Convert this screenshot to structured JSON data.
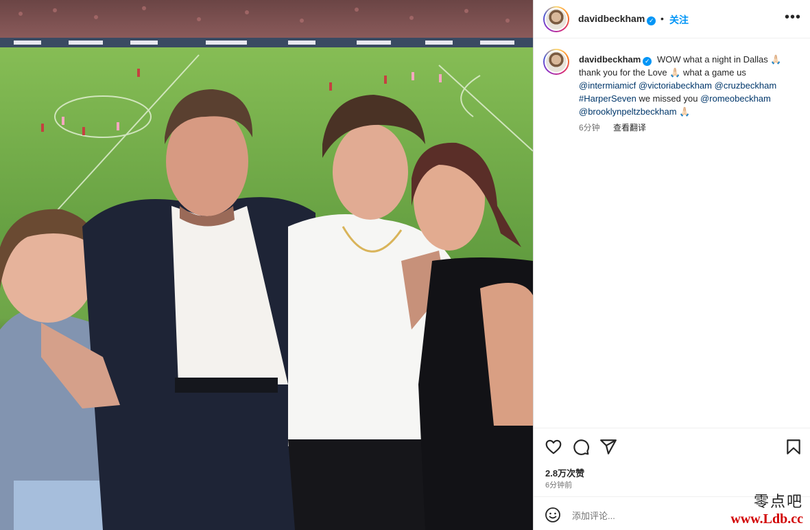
{
  "post": {
    "photo_alt": "",
    "header": {
      "username": "davidbeckham",
      "verified_mark": "✓",
      "separator": "•",
      "follow_label": "关注",
      "more_label": "•••"
    },
    "caption": {
      "username": "davidbeckham",
      "line1": "WOW what a night in Dallas 🙏🏻",
      "line2": "thank you for the Love 🙏🏻 what a game us",
      "mention1": "@intermiamicf",
      "mention2": "@victoriabeckham",
      "mention3": "@cruzbeckham",
      "hashtag": "#HarperSeven",
      "missed": "we missed you",
      "mention4": "@romeobeckham",
      "mention5": "@brooklynpeltzbeckham",
      "emoji_end": "🙏🏻",
      "age": "6分钟",
      "translate_label": "查看翻译"
    },
    "actions": {
      "like_icon": "heart-icon",
      "comment_icon": "comment-icon",
      "share_icon": "share-icon",
      "save_icon": "bookmark-icon"
    },
    "likes_label": "2.8万次赞",
    "time_label": "6分钟前",
    "comment": {
      "emoji_icon": "smiley-icon",
      "placeholder": "添加评论..."
    }
  },
  "watermark": {
    "cn": "零点吧",
    "url": "www.Ldb.cc"
  },
  "colors": {
    "link": "#00376b",
    "follow": "#0095f6",
    "muted": "#737373",
    "text": "#262626",
    "border": "#dbdbdb"
  }
}
